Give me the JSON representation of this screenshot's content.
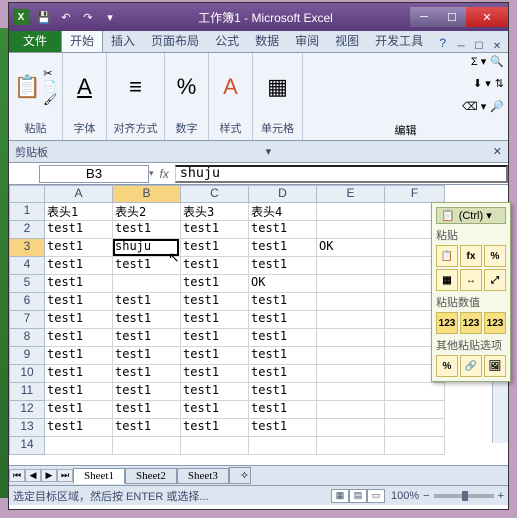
{
  "title": "工作簿1 - Microsoft Excel",
  "tabs": {
    "file": "文件",
    "home": "开始",
    "insert": "插入",
    "layout": "页面布局",
    "formula": "公式",
    "data": "数据",
    "review": "审阅",
    "view": "视图",
    "dev": "开发工具"
  },
  "ribbon": {
    "paste": "粘贴",
    "font": "字体",
    "align": "对齐方式",
    "number": "数字",
    "style": "样式",
    "cells": "单元格",
    "edit": "编辑"
  },
  "clipboard_pane": "剪贴板",
  "namebox": "B3",
  "formula": "shuju",
  "columns": [
    "A",
    "B",
    "C",
    "D",
    "E",
    "F"
  ],
  "rows": [
    "1",
    "2",
    "3",
    "4",
    "5",
    "6",
    "7",
    "8",
    "9",
    "10",
    "11",
    "12",
    "13",
    "14"
  ],
  "chart_data": {
    "type": "table",
    "columns": [
      "A",
      "B",
      "C",
      "D",
      "E"
    ],
    "data": [
      [
        "表头1",
        "表头2",
        "表头3",
        "表头4",
        ""
      ],
      [
        "test1",
        "test1",
        "test1",
        "test1",
        ""
      ],
      [
        "test1",
        "shuju",
        "test1",
        "test1",
        "OK"
      ],
      [
        "test1",
        "test1",
        "test1",
        "test1",
        ""
      ],
      [
        "test1",
        "",
        "test1",
        "OK",
        ""
      ],
      [
        "test1",
        "test1",
        "test1",
        "test1",
        ""
      ],
      [
        "test1",
        "test1",
        "test1",
        "test1",
        ""
      ],
      [
        "test1",
        "test1",
        "test1",
        "test1",
        ""
      ],
      [
        "test1",
        "test1",
        "test1",
        "test1",
        ""
      ],
      [
        "test1",
        "test1",
        "test1",
        "test1",
        ""
      ],
      [
        "test1",
        "test1",
        "test1",
        "test1",
        ""
      ],
      [
        "test1",
        "test1",
        "test1",
        "test1",
        ""
      ],
      [
        "test1",
        "test1",
        "test1",
        "test1",
        ""
      ],
      [
        "",
        "",
        "",
        "",
        ""
      ]
    ]
  },
  "paste_opts": {
    "ctrl": "(Ctrl) ▾",
    "paste": "粘贴",
    "values": "粘贴数值",
    "other": "其他粘贴选项",
    "val123": "123"
  },
  "sheets": {
    "s1": "Sheet1",
    "s2": "Sheet2",
    "s3": "Sheet3"
  },
  "status": "选定目标区域，然后按 ENTER 或选择...",
  "zoom": "100%"
}
